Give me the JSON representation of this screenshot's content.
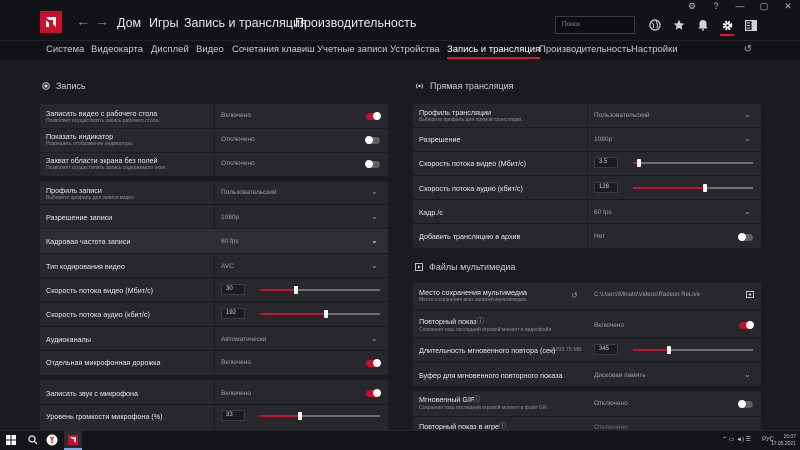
{
  "window": {
    "controls": [
      "⚙",
      "?",
      "—",
      "▢",
      "✕"
    ]
  },
  "nav": {
    "back": "←",
    "forward": "→",
    "items": [
      "Дом",
      "Игры",
      "Запись и трансляция",
      "Производительность"
    ]
  },
  "search": {
    "placeholder": "Поиск"
  },
  "top_icons": [
    "globe-icon",
    "star-icon",
    "bell-icon",
    "gear-icon",
    "sidebar-icon"
  ],
  "tabs": [
    "Система",
    "Видеокарта",
    "Дисплей",
    "Видео",
    "Сочетания клавиш",
    "Учетные записи",
    "Устройства",
    "Запись и трансляция",
    "Производительность",
    "Настройки"
  ],
  "active_tab": "Запись и трансляция",
  "left": {
    "section_title": "Запись",
    "card1": [
      {
        "label": "Записать видео с рабочего стола",
        "sub": "Позволяет осуществлять запись рабочего стола.",
        "value": "Включено",
        "toggle": "on"
      },
      {
        "label": "Показать индикатор",
        "sub": "Разрешить отображение индикатора.",
        "value": "Отключено",
        "toggle": "off"
      },
      {
        "label": "Захват области экрана без полей",
        "sub": "Позволяет осуществлять запись содержимого окон.",
        "value": "Отключено",
        "toggle": "off"
      }
    ],
    "card2": {
      "profile_label": "Профиль записи",
      "profile_sub": "Выберите профиль для записи видео.",
      "profile_value": "Пользовательский",
      "resolution_label": "Разрешение записи",
      "resolution_value": "1080p",
      "fps_label": "Кадровая частота записи",
      "fps_value": "60 fps",
      "codec_label": "Тип кодирования видео",
      "codec_value": "AVC",
      "vbitrate_label": "Скорость потока видео (Мбит/с)",
      "vbitrate_value": "30",
      "vbitrate_level": 0.3,
      "abitrate_label": "Скорость потока аудио (кбит/с)",
      "abitrate_value": "192",
      "abitrate_level": 0.55,
      "channels_label": "Аудиоканалы",
      "channels_value": "Автоматически",
      "mic_track_label": "Отдельная микрофонная дорожка",
      "mic_track_value": "Включено"
    },
    "card3": {
      "mic_label": "Записать звук с микрофона",
      "mic_value": "Включено",
      "vol_label": "Уровень громкости микрофона (%)",
      "vol_value": "33",
      "vol_level": 0.33
    }
  },
  "right": {
    "section_title": "Прямая трансляция",
    "card1": {
      "profile_label": "Профиль трансляции",
      "profile_sub": "Выберите профиль для прямой трансляции.",
      "profile_value": "Пользовательский",
      "resolution_label": "Разрешение",
      "resolution_value": "1080p",
      "vbitrate_label": "Скорость потока видео (Мбит/с)",
      "vbitrate_value": "3.5",
      "vbitrate_level": 0.05,
      "abitrate_label": "Скорость потока аудио (кбит/с)",
      "abitrate_value": "128",
      "abitrate_level": 0.6,
      "fps_label": "Кадр./с",
      "fps_value": "60 fps",
      "archive_label": "Добавить трансляцию в архив",
      "archive_value": "Нет"
    },
    "media_title": "Файлы мультимедиа",
    "card2": {
      "path_label": "Место сохранения мультимедиа",
      "path_sub": "Место сохранения всех записей мультимедиа.",
      "path_value": "C:\\Users\\Minato\\Videos\\Radeon ReLive",
      "replay_label": "Повторный показ",
      "replay_sub": "Сохраняет ваш последний игровой момент в видеофайл.",
      "replay_value": "Включено",
      "duration_label": "Длительность мгновенного повтора (сек)",
      "duration_size": "1293.75 MB",
      "duration_value": "345",
      "duration_level": 0.3,
      "buffer_label": "Буфер для мгновенного повторного показа",
      "buffer_value": "Дисковая память"
    },
    "card3": {
      "gif_label": "Мгновенный GIF",
      "gif_sub": "Сохраняет ваш последний игровой момент в файл GIF.",
      "gif_value": "Отключено",
      "ingame_label": "Повторный показ в игре",
      "ingame_value": "Отключено"
    }
  },
  "taskbar": {
    "lang": "РУС",
    "time": "15:07",
    "date": "17.05.2021"
  },
  "colors": {
    "accent": "#c8102e",
    "bg": "#1a1b1e",
    "card": "#26282c"
  }
}
